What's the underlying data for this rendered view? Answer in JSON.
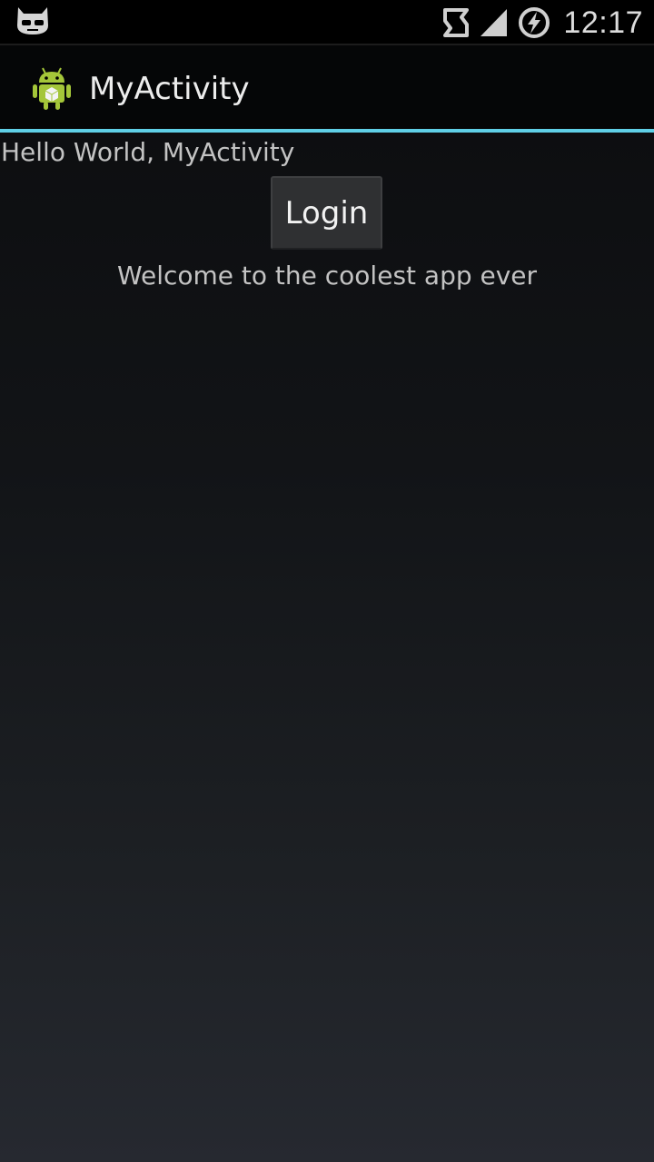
{
  "status_bar": {
    "left_icon": "cyanogenmod-mascot-icon",
    "icons": [
      "sync-icon",
      "signal-icon",
      "battery-charging-icon"
    ],
    "time": "12:17"
  },
  "action_bar": {
    "app_icon": "android-robot-icon",
    "title": "MyActivity",
    "divider_color": "#5fcfe6"
  },
  "content": {
    "hello_text": "Hello World, MyActivity",
    "login_button_label": "Login",
    "welcome_text": "Welcome to the coolest app ever"
  }
}
